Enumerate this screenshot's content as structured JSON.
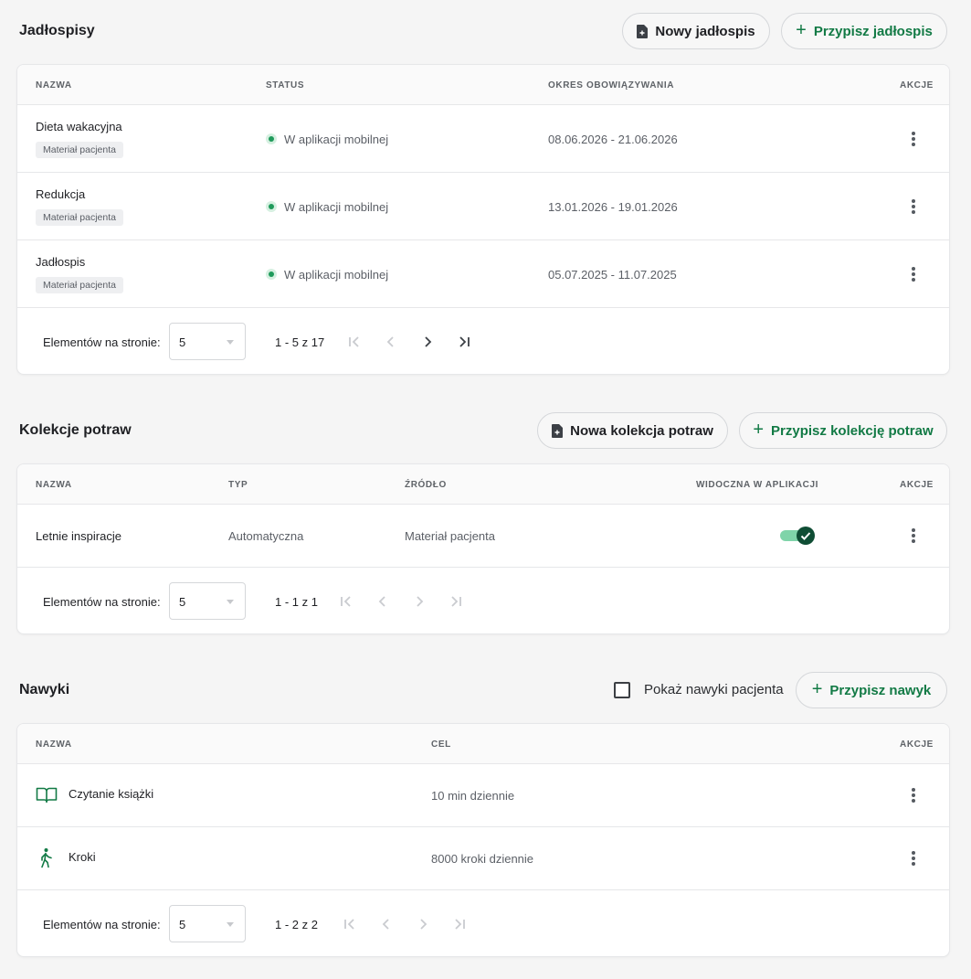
{
  "menus": {
    "title": "Jadłospisy",
    "btn_new": "Nowy jadłospis",
    "btn_assign": "Przypisz jadłospis",
    "headers": {
      "name": "NAZWA",
      "status": "STATUS",
      "period": "OKRES OBOWIĄZYWANIA",
      "actions": "AKCJE"
    },
    "rows": [
      {
        "name": "Dieta wakacyjna",
        "tag": "Materiał pacjenta",
        "status": "W aplikacji mobilnej",
        "period": "08.06.2026 - 21.06.2026"
      },
      {
        "name": "Redukcja",
        "tag": "Materiał pacjenta",
        "status": "W aplikacji mobilnej",
        "period": "13.01.2026 - 19.01.2026"
      },
      {
        "name": "Jadłospis",
        "tag": "Materiał pacjenta",
        "status": "W aplikacji mobilnej",
        "period": "05.07.2025 - 11.07.2025"
      }
    ],
    "pager": {
      "label": "Elementów na stronie:",
      "per_page": "5",
      "range": "1 - 5 z 17"
    }
  },
  "collections": {
    "title": "Kolekcje potraw",
    "btn_new": "Nowa kolekcja potraw",
    "btn_assign": "Przypisz kolekcję potraw",
    "headers": {
      "name": "NAZWA",
      "type": "TYP",
      "source": "ŹRÓDŁO",
      "visible": "WIDOCZNA W APLIKACJI",
      "actions": "AKCJE"
    },
    "rows": [
      {
        "name": "Letnie inspiracje",
        "type": "Automatyczna",
        "source": "Materiał pacjenta",
        "visible": true
      }
    ],
    "pager": {
      "label": "Elementów na stronie:",
      "per_page": "5",
      "range": "1 - 1 z 1"
    }
  },
  "habits": {
    "title": "Nawyki",
    "checkbox_label": "Pokaż nawyki pacjenta",
    "btn_assign": "Przypisz nawyk",
    "headers": {
      "name": "NAZWA",
      "goal": "CEL",
      "actions": "AKCJE"
    },
    "rows": [
      {
        "icon": "book-icon",
        "name": "Czytanie książki",
        "goal": "10 min dziennie"
      },
      {
        "icon": "walking-icon",
        "name": "Kroki",
        "goal": "8000 kroki dziennie"
      }
    ],
    "pager": {
      "label": "Elementów na stronie:",
      "per_page": "5",
      "range": "1 - 2 z 2"
    }
  },
  "colors": {
    "accent_green": "#127a45",
    "status_green": "#1f9a5b",
    "toggle_on": "#0f4d34"
  }
}
